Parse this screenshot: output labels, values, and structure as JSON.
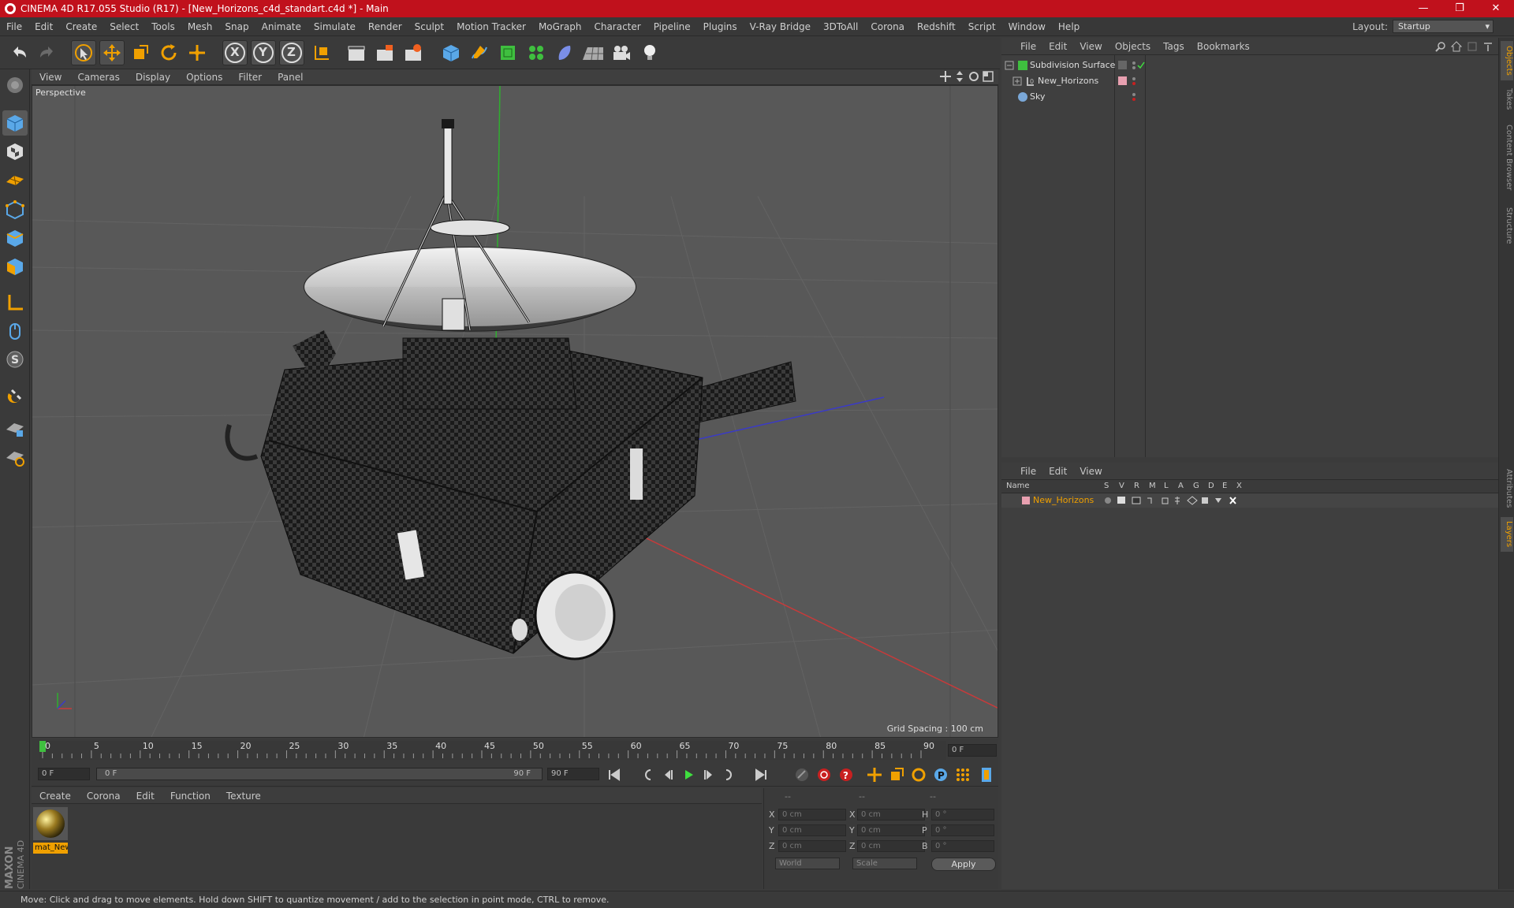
{
  "window": {
    "title": "CINEMA 4D R17.055 Studio (R17) - [New_Horizons_c4d_standart.c4d *] - Main",
    "minimize": "—",
    "maximize": "❐",
    "close": "✕"
  },
  "menubar": {
    "items": [
      "File",
      "Edit",
      "Create",
      "Select",
      "Tools",
      "Mesh",
      "Snap",
      "Animate",
      "Simulate",
      "Render",
      "Sculpt",
      "Motion Tracker",
      "MoGraph",
      "Character",
      "Pipeline",
      "Plugins",
      "V-Ray Bridge",
      "3DToAll",
      "Corona",
      "Redshift",
      "Script",
      "Window",
      "Help"
    ],
    "layout_label": "Layout:",
    "layout_value": "Startup"
  },
  "toolbar": {
    "axis_x": "X",
    "axis_y": "Y",
    "axis_z": "Z"
  },
  "viewport": {
    "menu": [
      "View",
      "Cameras",
      "Display",
      "Options",
      "Filter",
      "Panel"
    ],
    "camera_label": "Perspective",
    "grid_spacing": "Grid Spacing : 100 cm"
  },
  "timeline": {
    "ticks": [
      "0",
      "5",
      "10",
      "15",
      "20",
      "25",
      "30",
      "35",
      "40",
      "45",
      "50",
      "55",
      "60",
      "65",
      "70",
      "75",
      "80",
      "85",
      "90"
    ],
    "current_frame": "0 F",
    "start_field": "0 F",
    "range_start": "0 F",
    "range_end": "90 F",
    "end_field": "90 F"
  },
  "material_manager": {
    "menu": [
      "Create",
      "Corona",
      "Edit",
      "Function",
      "Texture"
    ],
    "material_name": "mat_New"
  },
  "coordinates": {
    "header": [
      "--",
      "--",
      "--"
    ],
    "rows": [
      {
        "l1": "X",
        "v1": "0 cm",
        "l2": "X",
        "v2": "0 cm",
        "l3": "H",
        "v3": "0 °"
      },
      {
        "l1": "Y",
        "v1": "0 cm",
        "l2": "Y",
        "v2": "0 cm",
        "l3": "P",
        "v3": "0 °"
      },
      {
        "l1": "Z",
        "v1": "0 cm",
        "l2": "Z",
        "v2": "0 cm",
        "l3": "B",
        "v3": "0 °"
      }
    ],
    "mode_world": "World",
    "mode_scale": "Scale",
    "apply": "Apply"
  },
  "object_manager": {
    "menu": [
      "File",
      "Edit",
      "View",
      "Objects",
      "Tags",
      "Bookmarks"
    ],
    "objects": [
      {
        "name": "Subdivision Surface"
      },
      {
        "name": "New_Horizons"
      },
      {
        "name": "Sky"
      }
    ]
  },
  "layer_manager": {
    "menu": [
      "File",
      "Edit",
      "View"
    ],
    "columns": [
      "Name",
      "S",
      "V",
      "R",
      "M",
      "L",
      "A",
      "G",
      "D",
      "E",
      "X"
    ],
    "layers": [
      {
        "name": "New_Horizons",
        "color": "#e8a0b0"
      }
    ]
  },
  "right_tabs": [
    "Objects",
    "Takes",
    "Content Browser",
    "Structure",
    "Attributes",
    "Layers"
  ],
  "brand": {
    "maxon": "MAXON",
    "cinema": "CINEMA 4D"
  },
  "statusbar": {
    "text": "Move: Click and drag to move elements. Hold down SHIFT to quantize movement / add to the selection in point mode, CTRL to remove."
  },
  "colors": {
    "titlebar": "#c0111c",
    "accent": "#f0a000",
    "layer_name": "#f0a000"
  }
}
